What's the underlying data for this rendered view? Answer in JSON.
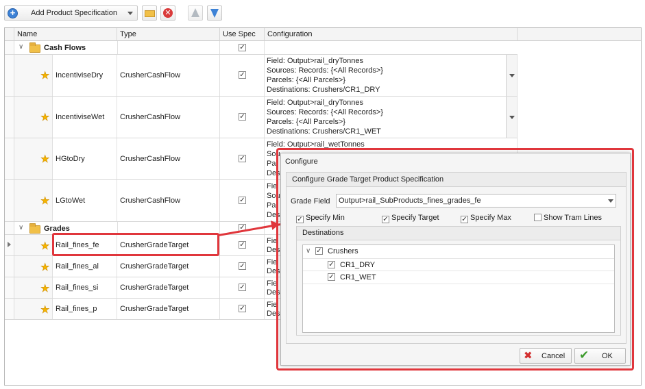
{
  "toolbar": {
    "add_label": "Add Product Specification"
  },
  "grid": {
    "columns": [
      "Name",
      "Type",
      "Use Spec",
      "Configuration"
    ],
    "groups": [
      {
        "title": "Cash Flows",
        "rows": [
          {
            "name": "IncentiviseDry",
            "type": "CrusherCashFlow",
            "use_spec": true,
            "config": [
              "Field: Output>rail_dryTonnes",
              "Sources: Records: {<All Records>}",
              "Parcels: {<All Parcels>}",
              "Destinations: Crushers/CR1_DRY"
            ]
          },
          {
            "name": "IncentiviseWet",
            "type": "CrusherCashFlow",
            "use_spec": true,
            "config": [
              "Field: Output>rail_dryTonnes",
              "Sources: Records: {<All Records>}",
              "Parcels: {<All Parcels>}",
              "Destinations: Crushers/CR1_WET"
            ]
          },
          {
            "name": "HGtoDry",
            "type": "CrusherCashFlow",
            "use_spec": true,
            "config": [
              "Field: Output>rail_wetTonnes",
              "Sou",
              "Par",
              "Des"
            ]
          },
          {
            "name": "LGtoWet",
            "type": "CrusherCashFlow",
            "use_spec": true,
            "config": [
              "Fiel",
              "Sou",
              "Par",
              "Des"
            ]
          }
        ]
      },
      {
        "title": "Grades",
        "rows": [
          {
            "name": "Rail_fines_fe",
            "type": "CrusherGradeTarget",
            "use_spec": true,
            "config": [
              "Fiel",
              "Des"
            ]
          },
          {
            "name": "Rail_fines_al",
            "type": "CrusherGradeTarget",
            "use_spec": true,
            "config": [
              "Fiel",
              "Des"
            ]
          },
          {
            "name": "Rail_fines_si",
            "type": "CrusherGradeTarget",
            "use_spec": true,
            "config": [
              "Fiel",
              "Des"
            ]
          },
          {
            "name": "Rail_fines_p",
            "type": "CrusherGradeTarget",
            "use_spec": true,
            "config": [
              "Fiel",
              "Des"
            ]
          }
        ]
      }
    ]
  },
  "dialog": {
    "title": "Configure",
    "group_title": "Configure Grade Target Product Specification",
    "grade_field_label": "Grade Field",
    "grade_field_value": "Output>rail_SubProducts_fines_grades_fe",
    "options": [
      {
        "label": "Specify Min",
        "checked": true
      },
      {
        "label": "Specify Target",
        "checked": true
      },
      {
        "label": "Specify Max",
        "checked": true
      },
      {
        "label": "Show Tram Lines",
        "checked": false
      }
    ],
    "destinations_title": "Destinations",
    "tree": {
      "root": {
        "label": "Crushers",
        "checked": true
      },
      "children": [
        {
          "label": "CR1_DRY",
          "checked": true
        },
        {
          "label": "CR1_WET",
          "checked": true
        }
      ]
    },
    "cancel_label": "Cancel",
    "ok_label": "OK"
  },
  "colors": {
    "highlight": "#e0363c",
    "accent_blue": "#3d82d6"
  }
}
